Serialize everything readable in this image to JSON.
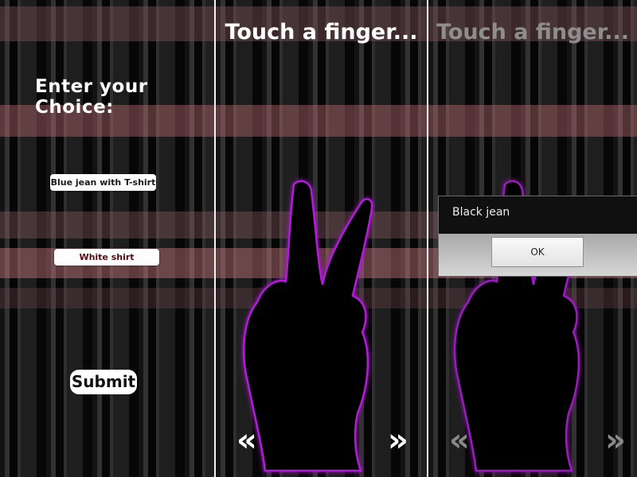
{
  "screen1": {
    "title": "Enter your Choice:",
    "options": [
      "Blue jean with T-shirt",
      "White shirt"
    ],
    "submit_label": "Submit"
  },
  "screen2": {
    "prompt": "Touch a finger...",
    "prev_label": "«",
    "next_label": "»"
  },
  "screen3": {
    "prompt": "Touch a finger...",
    "prev_label": "«",
    "next_label": "»",
    "dialog": {
      "message": "Black jean",
      "ok_label": "OK"
    }
  },
  "colors": {
    "hand_glow": "#b21fd8",
    "hand_fill": "#000000",
    "separator": "#f2f2f2"
  },
  "icons": [
    "peace-sign-hand-icon",
    "double-chevron-left-icon",
    "double-chevron-right-icon"
  ]
}
